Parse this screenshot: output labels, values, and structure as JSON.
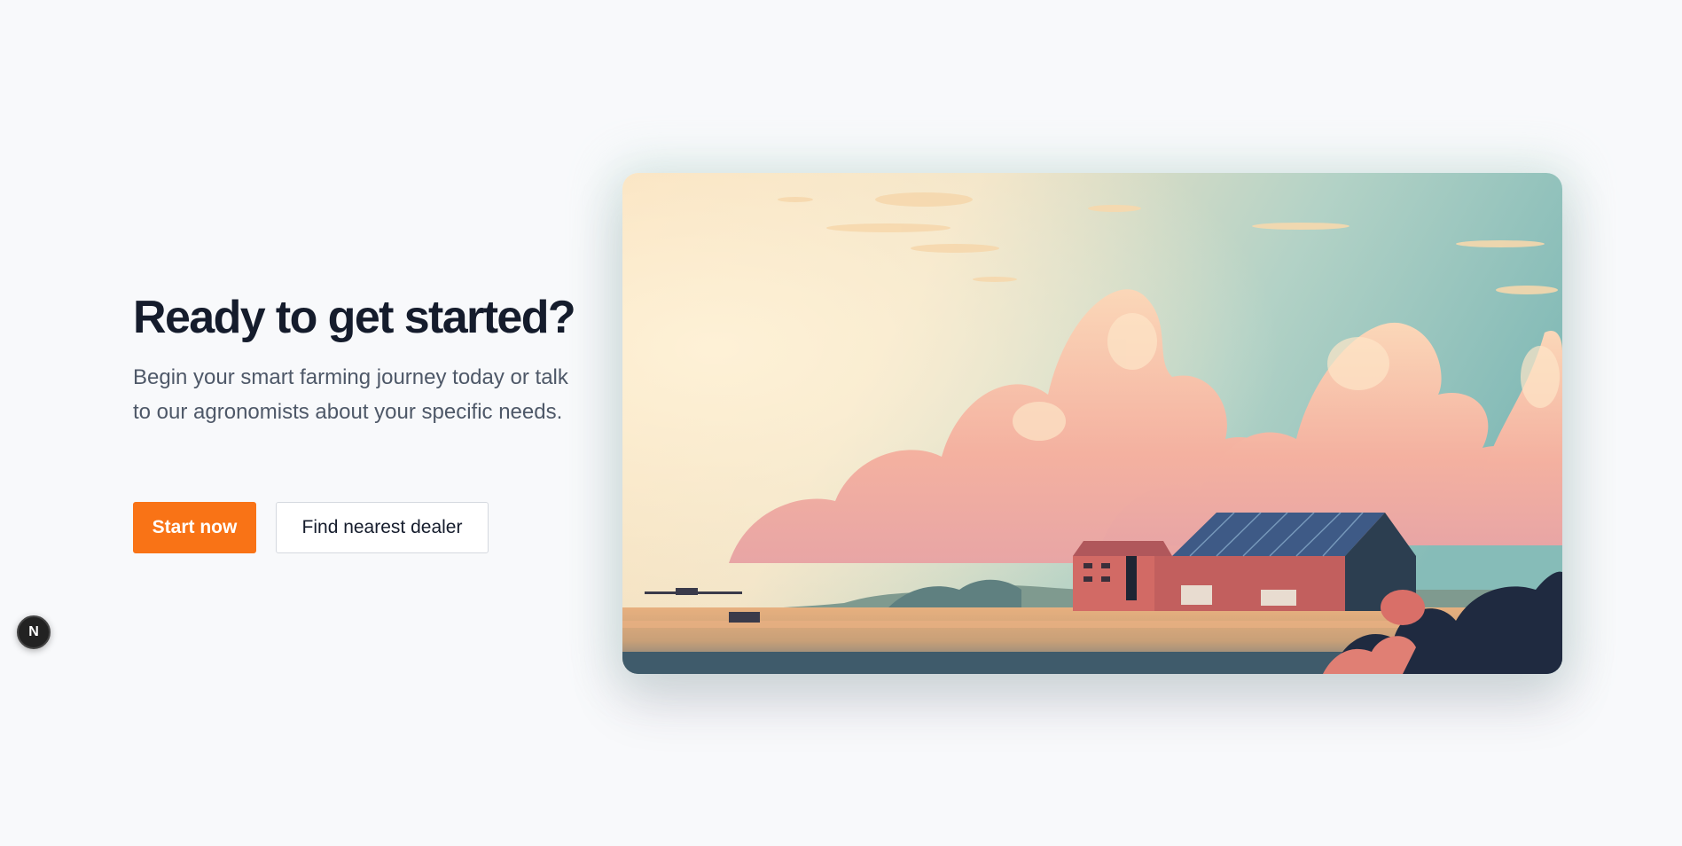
{
  "cta": {
    "heading": "Ready to get started?",
    "description": "Begin your smart farming journey today or talk to our agronomists about your specific needs.",
    "primary_button": "Start now",
    "secondary_button": "Find nearest dealer"
  },
  "dev_badge": {
    "letter": "N"
  },
  "colors": {
    "background": "#f8f9fb",
    "heading": "#151c2c",
    "body_text": "#4e5868",
    "accent": "#f97316"
  },
  "hero_image": {
    "icon": "farm-landscape-illustration"
  }
}
